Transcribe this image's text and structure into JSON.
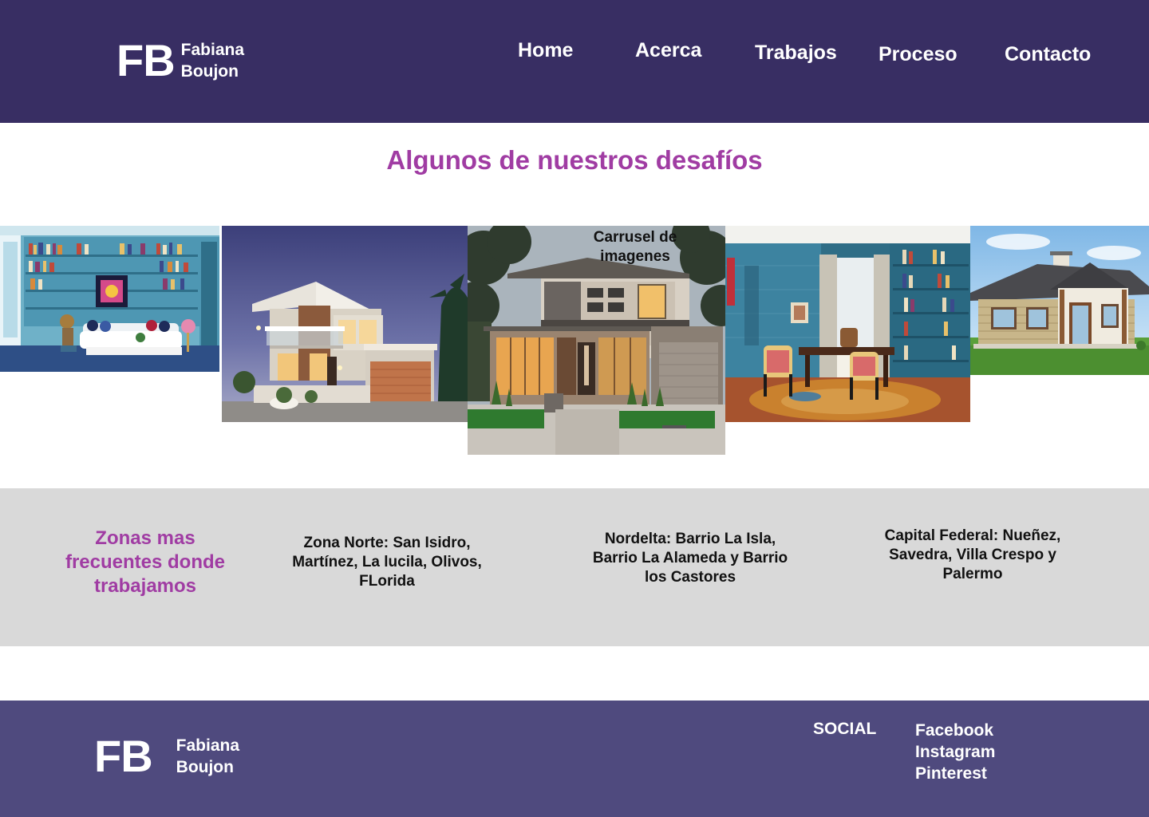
{
  "brand": {
    "mark": "FB",
    "first_name": "Fabiana",
    "last_name": "Boujon"
  },
  "nav": {
    "home": "Home",
    "about": "Acerca",
    "works": "Trabajos",
    "process": "Proceso",
    "contact": "Contacto"
  },
  "works_section": {
    "title": "Algunos de nuestros desafíos",
    "carousel_label": "Carrusel de imagenes",
    "slides": [
      "blue-library-living-room",
      "modern-two-story-house-dusk",
      "modern-house-front-night",
      "blue-study-room",
      "small-country-house"
    ]
  },
  "zones": {
    "title": "Zonas mas frecuentes donde trabajamos",
    "items": [
      "Zona Norte: San Isidro, Martínez, La lucila, Olivos, FLorida",
      "Nordelta: Barrio La Isla, Barrio La Alameda y Barrio los Castores",
      "Capital Federal: Nueñez, Savedra, Villa Crespo y Palermo"
    ]
  },
  "footer": {
    "social_title": "SOCIAL",
    "links": [
      "Facebook",
      "Instagram",
      "Pinterest"
    ]
  },
  "colors": {
    "header_bg": "#382e63",
    "footer_bg": "#4f4a7e",
    "accent": "#a03ca3",
    "zones_bg": "#d9d9d9"
  }
}
